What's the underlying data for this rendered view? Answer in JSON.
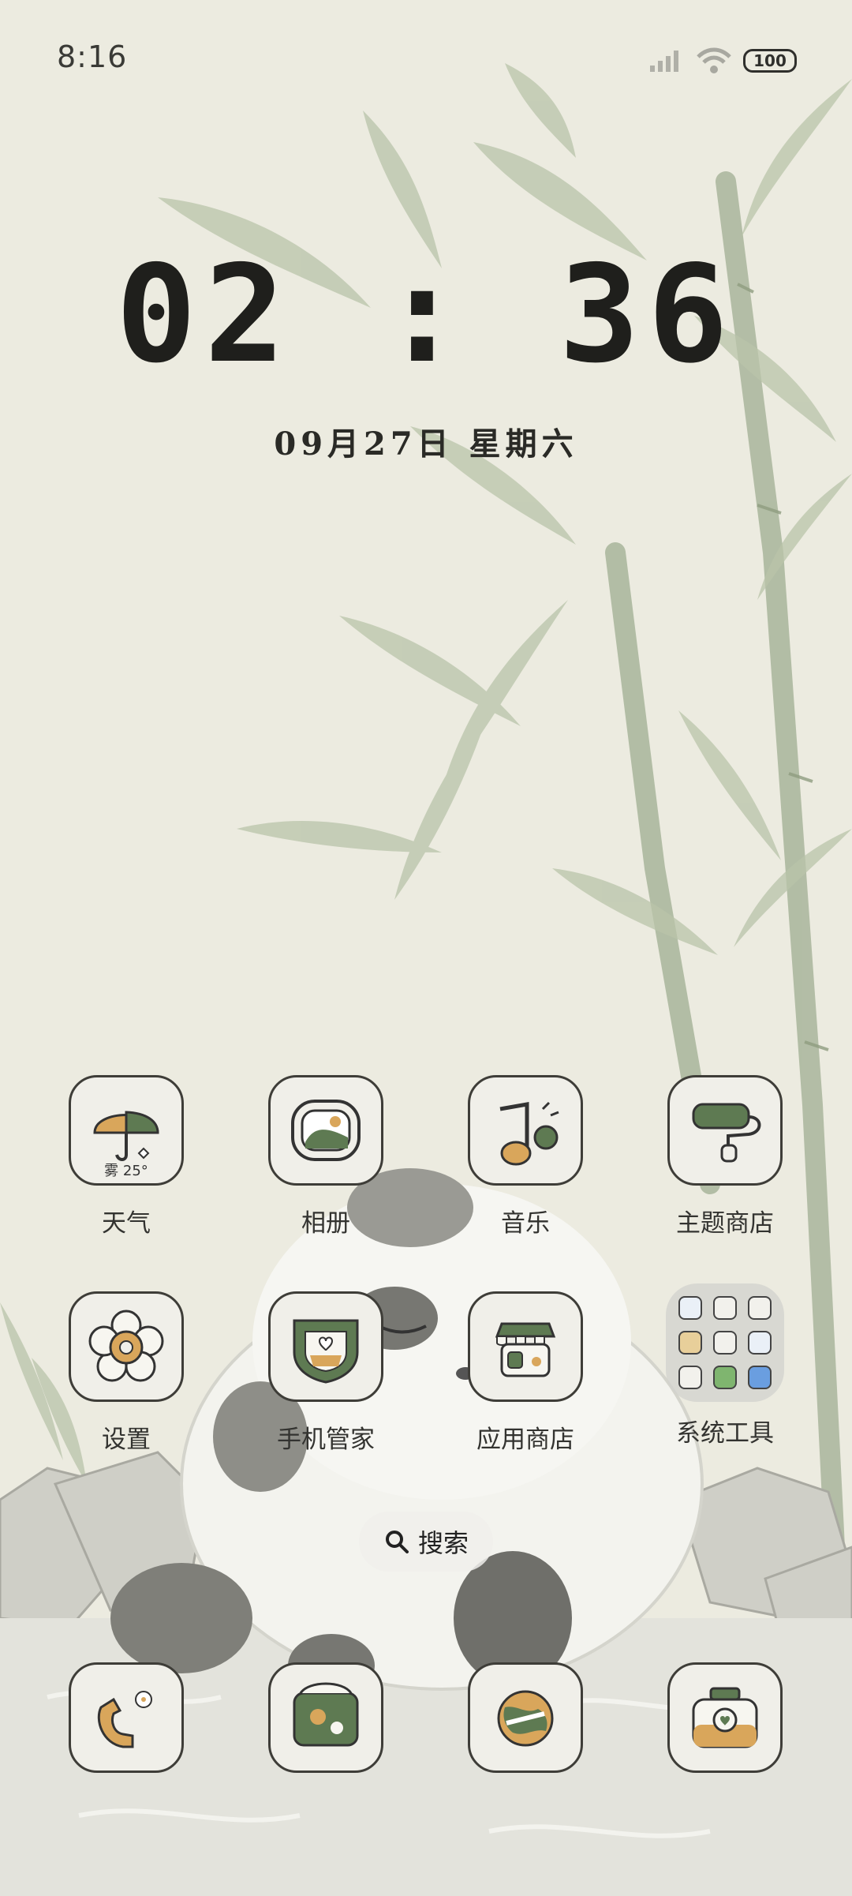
{
  "status_bar": {
    "time": "8:16",
    "battery": "100"
  },
  "clock": {
    "time": "02 : 36",
    "date": "09月27日 星期六"
  },
  "apps_row1": [
    {
      "label": "天气",
      "icon": "weather-umbrella-icon",
      "temp": "雾 25°"
    },
    {
      "label": "相册",
      "icon": "gallery-icon"
    },
    {
      "label": "音乐",
      "icon": "music-icon"
    },
    {
      "label": "主题商店",
      "icon": "theme-store-icon"
    }
  ],
  "apps_row2": [
    {
      "label": "设置",
      "icon": "settings-flower-icon"
    },
    {
      "label": "手机管家",
      "icon": "phone-manager-icon"
    },
    {
      "label": "应用商店",
      "icon": "app-store-icon"
    },
    {
      "label": "系统工具",
      "icon": "folder-icon"
    }
  ],
  "search": {
    "label": "搜索"
  },
  "dock": [
    {
      "icon": "phone-icon"
    },
    {
      "icon": "messages-icon"
    },
    {
      "icon": "browser-icon"
    },
    {
      "icon": "camera-icon"
    }
  ],
  "colors": {
    "accent_green": "#5e7a52",
    "accent_orange": "#d9a65b",
    "outline": "#3e3d38"
  }
}
